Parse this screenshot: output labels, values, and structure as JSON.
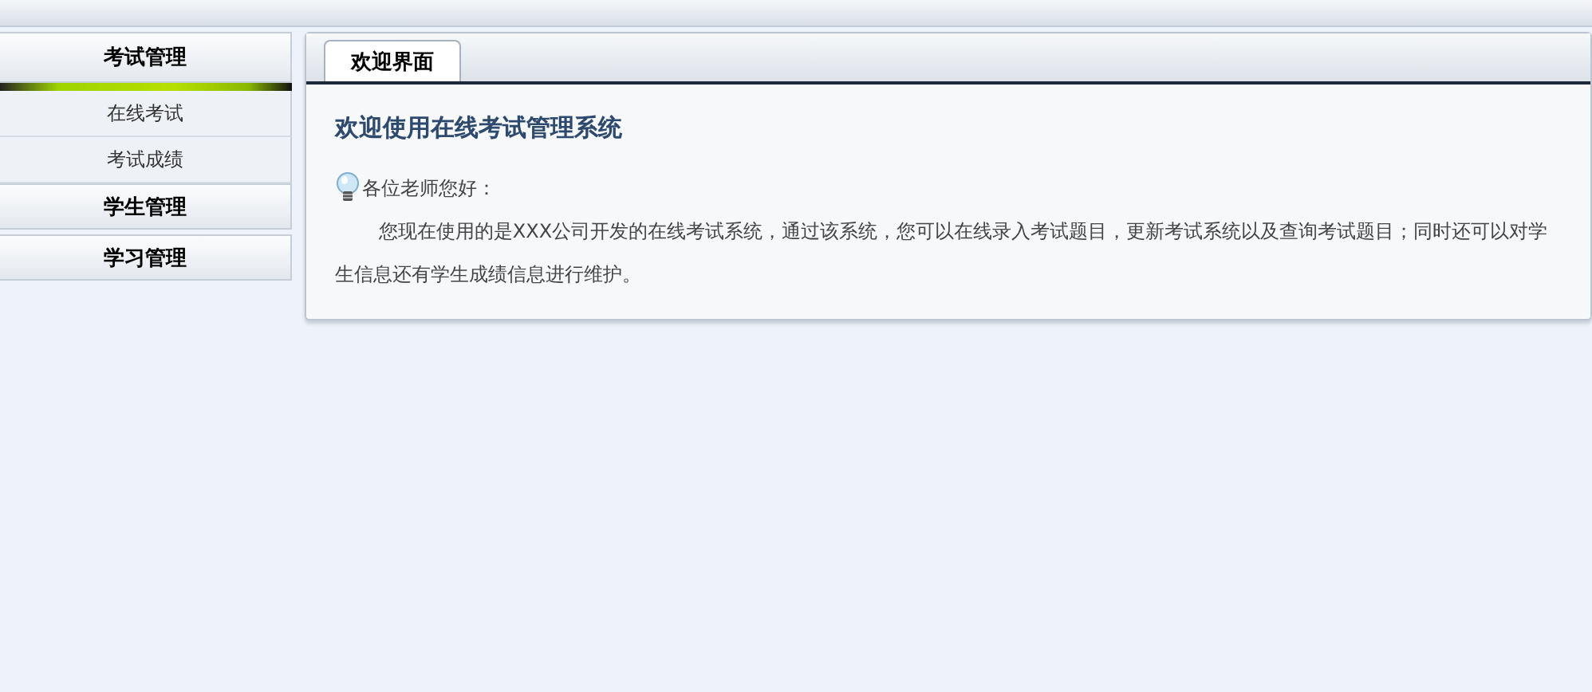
{
  "sidebar": {
    "groups": [
      {
        "label": "考试管理",
        "expanded": true,
        "items": [
          {
            "label": "在线考试"
          },
          {
            "label": "考试成绩"
          }
        ]
      },
      {
        "label": "学生管理",
        "expanded": false
      },
      {
        "label": "学习管理",
        "expanded": false
      }
    ]
  },
  "tabs": [
    {
      "label": "欢迎界面",
      "selected": true
    }
  ],
  "content": {
    "heading": "欢迎使用在线考试管理系统",
    "greeting": "各位老师您好：",
    "body": "您现在使用的是XXX公司开发的在线考试系统，通过该系统，您可以在线录入考试题目，更新考试系统以及查询考试题目；同时还可以对学生信息还有学生成绩信息进行维护。"
  }
}
